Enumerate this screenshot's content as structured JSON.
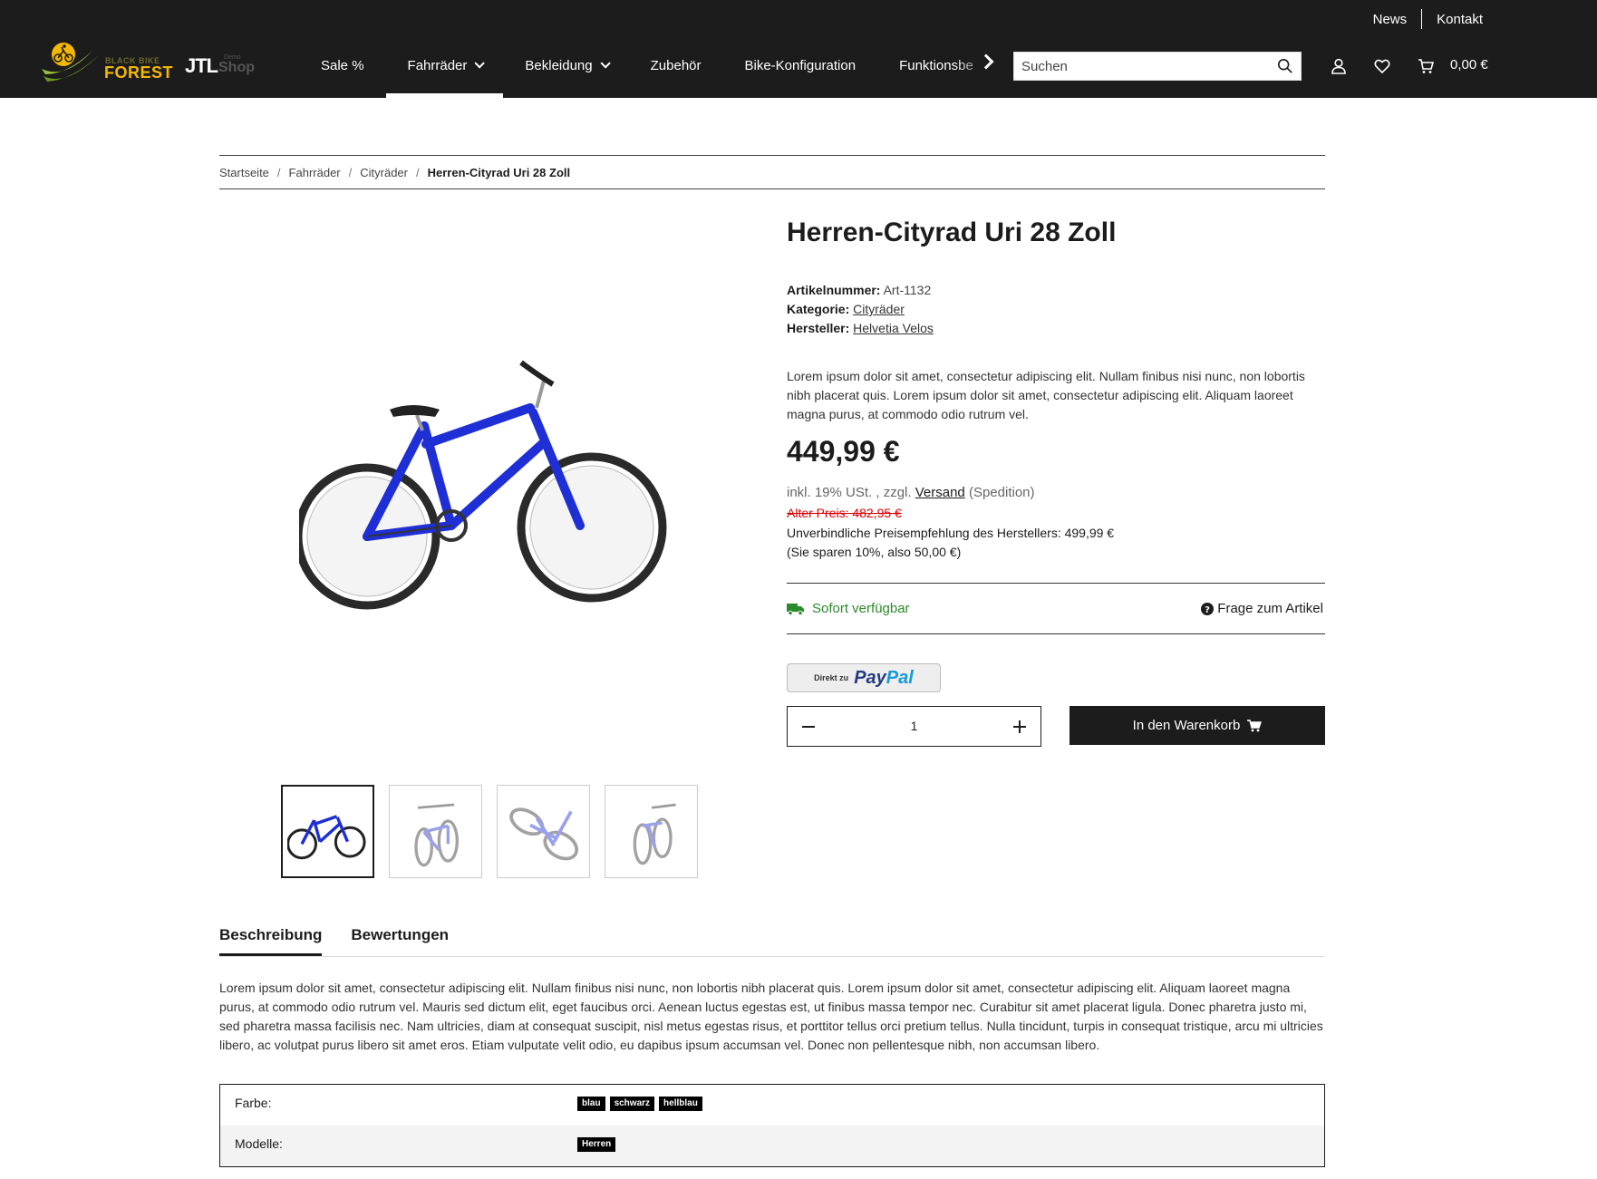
{
  "header": {
    "top_links": [
      "News",
      "Kontakt"
    ],
    "logo": {
      "line1": "BLACK BIKE",
      "line2": "FOREST"
    },
    "jtl": {
      "brand": "JTL",
      "shop": "Shop",
      "demo": "Demo"
    },
    "nav": [
      {
        "label": "Sale %",
        "dropdown": false
      },
      {
        "label": "Fahrräder",
        "dropdown": true,
        "active": true
      },
      {
        "label": "Bekleidung",
        "dropdown": true
      },
      {
        "label": "Zubehör",
        "dropdown": false
      },
      {
        "label": "Bike-Konfiguration",
        "dropdown": false
      },
      {
        "label": "Funktionsbe",
        "dropdown": false
      }
    ],
    "search_placeholder": "Suchen",
    "cart_total": "0,00 €"
  },
  "breadcrumb": [
    "Startseite",
    "Fahrräder",
    "Cityräder",
    "Herren-Cityrad Uri 28 Zoll"
  ],
  "product": {
    "title": "Herren-Cityrad Uri 28 Zoll",
    "sku_label": "Artikelnummer:",
    "sku": "Art-1132",
    "category_label": "Kategorie:",
    "category": "Cityräder",
    "manufacturer_label": "Hersteller:",
    "manufacturer": "Helvetia Velos",
    "short_description": "Lorem ipsum dolor sit amet, consectetur adipiscing elit. Nullam finibus nisi nunc, non lobortis nibh placerat quis. Lorem ipsum dolor sit amet, consectetur adipiscing elit. Aliquam laoreet magna purus, at commodo odio rutrum vel.",
    "price": "449,99 €",
    "tax_prefix": "inkl. 19% USt. , zzgl.",
    "shipping_link": "Versand",
    "shipping_suffix": "(Spedition)",
    "old_price": "Alter Preis: 482,95 €",
    "uvp": "Unverbindliche Preisempfehlung des Herstellers: 499,99 €",
    "savings": "(Sie sparen 10%, also 50,00 €)",
    "availability": "Sofort verfügbar",
    "question_link": "Frage zum Artikel",
    "paypal_prefix": "Direkt zu",
    "paypal_word1": "Pay",
    "paypal_word2": "Pal",
    "quantity": "1",
    "add_to_cart": "In den Warenkorb",
    "bike_color": "#1f2fd6",
    "availability_color": "#2b8a2b"
  },
  "tabs": [
    "Beschreibung",
    "Bewertungen"
  ],
  "description": "Lorem ipsum dolor sit amet, consectetur adipiscing elit. Nullam finibus nisi nunc, non lobortis nibh placerat quis. Lorem ipsum dolor sit amet, consectetur adipiscing elit. Aliquam laoreet magna purus, at commodo odio rutrum vel. Mauris sed dictum elit, eget faucibus orci. Aenean luctus egestas est, ut finibus massa tempor nec. Curabitur sit amet placerat ligula. Donec pharetra justo mi, sed pharetra massa facilisis nec. Nam ultricies, diam at consequat suscipit, nisl metus egestas risus, et porttitor tellus orci pretium tellus. Nulla tincidunt, turpis in consequat tristique, arcu mi ultricies libero, ac volutpat purus libero sit amet eros. Etiam vulputate velit odio, eu dapibus ipsum accumsan vel. Donec non pellentesque nibh, non accumsan libero.",
  "attributes": [
    {
      "label": "Farbe:",
      "values": [
        "blau",
        "schwarz",
        "hellblau"
      ]
    },
    {
      "label": "Modelle:",
      "values": [
        "Herren"
      ]
    }
  ]
}
